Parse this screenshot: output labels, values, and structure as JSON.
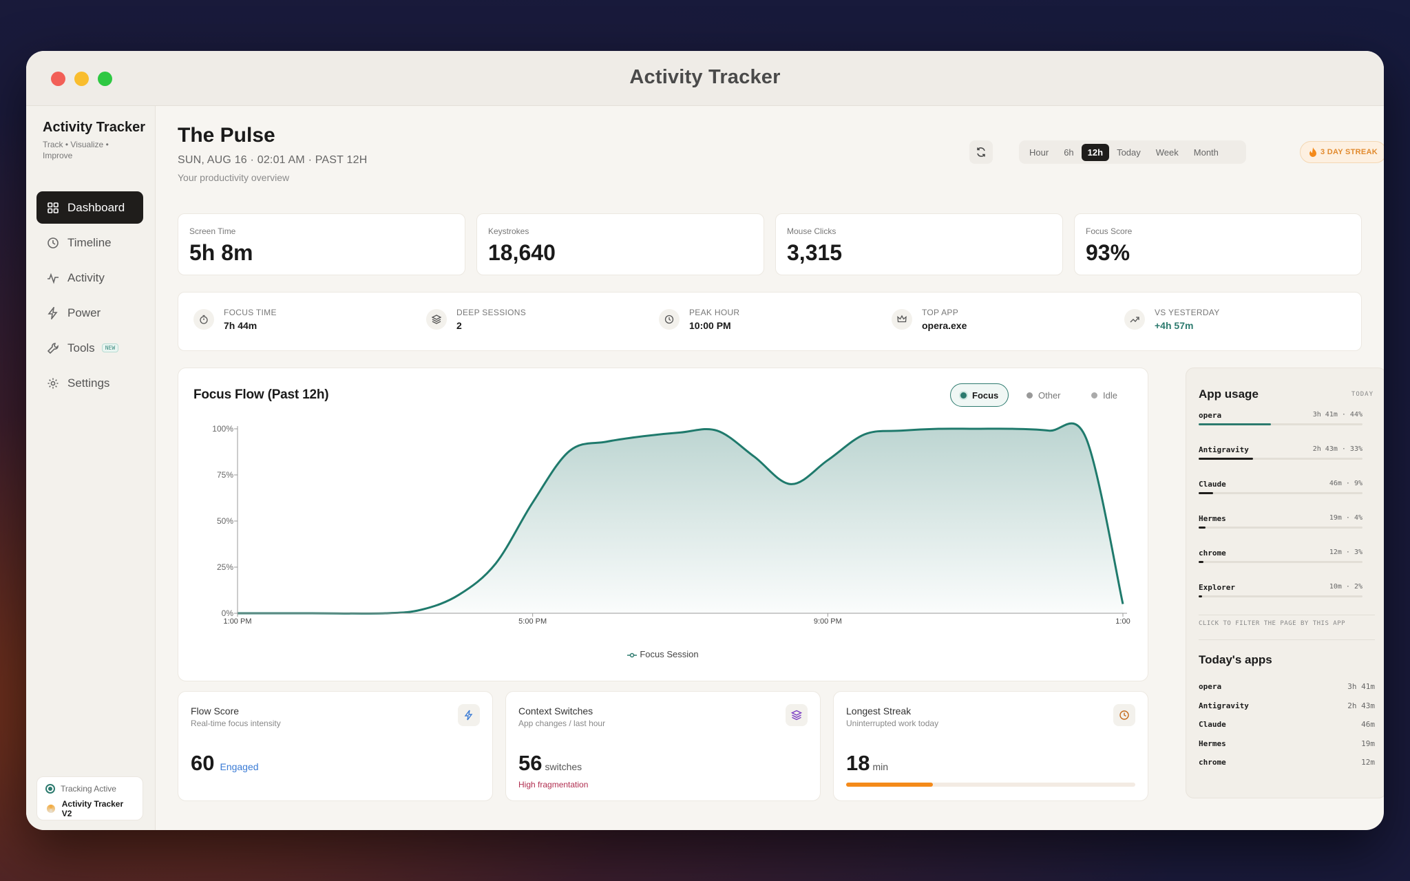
{
  "window": {
    "title": "Activity Tracker"
  },
  "sidebar": {
    "brand": "Activity Tracker",
    "brand_sub": "Track • Visualize • Improve",
    "items": [
      {
        "label": "Dashboard",
        "icon": "grid-icon",
        "active": true
      },
      {
        "label": "Timeline",
        "icon": "clock-icon"
      },
      {
        "label": "Activity",
        "icon": "pulse-icon"
      },
      {
        "label": "Power",
        "icon": "bolt-icon"
      },
      {
        "label": "Tools",
        "icon": "wrench-icon",
        "badge": "NEW"
      },
      {
        "label": "Settings",
        "icon": "gear-icon"
      }
    ],
    "tracking_status": "Tracking Active",
    "version": "Activity Tracker V2"
  },
  "header": {
    "title": "The Pulse",
    "date": "SUN, AUG 16 · 02:01 AM · PAST 12H",
    "subtitle": "Your productivity overview",
    "ranges": [
      "Hour",
      "6h",
      "12h",
      "Today",
      "Week",
      "Month"
    ],
    "active_range": "12h",
    "streak": "3 DAY STREAK"
  },
  "stats": [
    {
      "label": "Screen Time",
      "value": "5h 8m"
    },
    {
      "label": "Keystrokes",
      "value": "18,640"
    },
    {
      "label": "Mouse Clicks",
      "value": "3,315"
    },
    {
      "label": "Focus Score",
      "value": "93%"
    }
  ],
  "summary": [
    {
      "label": "FOCUS TIME",
      "value": "7h 44m",
      "icon": "timer-icon"
    },
    {
      "label": "DEEP SESSIONS",
      "value": "2",
      "icon": "layers-icon"
    },
    {
      "label": "PEAK HOUR",
      "value": "10:00 PM",
      "icon": "clock-icon"
    },
    {
      "label": "TOP APP",
      "value": "opera.exe",
      "icon": "crown-icon"
    },
    {
      "label": "VS YESTERDAY",
      "value": "+4h 57m",
      "icon": "trend-up-icon"
    }
  ],
  "focus_chart": {
    "title": "Focus Flow (Past 12h)",
    "legend": [
      "Focus",
      "Other",
      "Idle"
    ],
    "bottom_legend": "Focus Session"
  },
  "chart_data": {
    "type": "area",
    "title": "Focus Flow (Past 12h)",
    "x_ticks": [
      "1:00 PM",
      "5:00 PM",
      "9:00 PM",
      "1:00"
    ],
    "y_ticks": [
      "0%",
      "25%",
      "50%",
      "75%",
      "100%"
    ],
    "ylim": [
      0,
      100
    ],
    "series": [
      {
        "name": "Focus Session",
        "x_hours": [
          0,
          1,
          2,
          2.5,
          3,
          3.5,
          4,
          4.5,
          5,
          5.5,
          6,
          6.5,
          7,
          7.5,
          8,
          8.5,
          9,
          9.5,
          10,
          10.5,
          11,
          11.5,
          12
        ],
        "values": [
          0,
          0,
          0,
          2,
          10,
          27,
          60,
          88,
          93,
          96,
          98,
          99,
          85,
          70,
          83,
          97,
          99,
          100,
          100,
          100,
          99,
          95,
          5
        ]
      }
    ],
    "grid": false,
    "legend_position": "top-right"
  },
  "app_usage": {
    "title": "App usage",
    "period": "TODAY",
    "items": [
      {
        "name": "opera",
        "meta": "3h 41m · 44%",
        "pct": 44,
        "teal": true
      },
      {
        "name": "Antigravity",
        "meta": "2h 43m · 33%",
        "pct": 33
      },
      {
        "name": "Claude",
        "meta": "46m · 9%",
        "pct": 9
      },
      {
        "name": "Hermes",
        "meta": "19m · 4%",
        "pct": 4
      },
      {
        "name": "chrome",
        "meta": "12m · 3%",
        "pct": 3
      },
      {
        "name": "Explorer",
        "meta": "10m · 2%",
        "pct": 2
      }
    ],
    "hint": "CLICK TO FILTER THE PAGE BY THIS APP"
  },
  "todays_apps": {
    "title": "Today's apps",
    "items": [
      {
        "name": "opera",
        "time": "3h 41m"
      },
      {
        "name": "Antigravity",
        "time": "2h 43m"
      },
      {
        "name": "Claude",
        "time": "46m"
      },
      {
        "name": "Hermes",
        "time": "19m"
      },
      {
        "name": "chrome",
        "time": "12m"
      }
    ]
  },
  "metrics": {
    "flow": {
      "title": "Flow Score",
      "sub": "Real-time focus intensity",
      "value": "60",
      "tag": "Engaged"
    },
    "context": {
      "title": "Context Switches",
      "sub": "App changes / last hour",
      "value": "56",
      "unit": "switches",
      "note": "High fragmentation"
    },
    "streak": {
      "title": "Longest Streak",
      "sub": "Uninterrupted work today",
      "value": "18",
      "unit": "min",
      "progress": 0.3
    }
  },
  "colors": {
    "accent": "#2c7a6e",
    "dark": "#1f1d1b",
    "orange": "#f48a1a"
  }
}
